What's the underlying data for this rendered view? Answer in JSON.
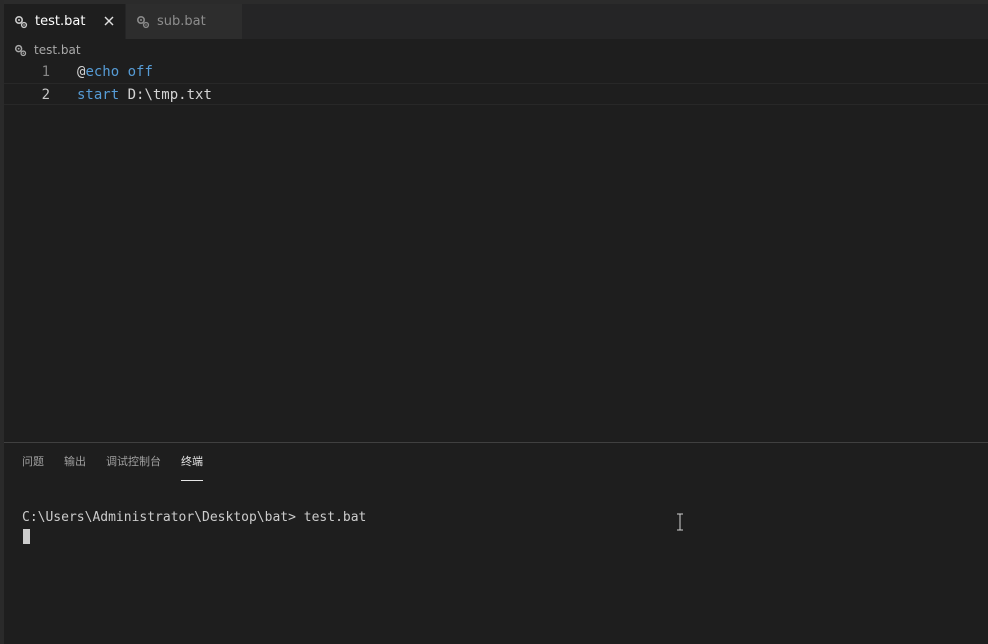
{
  "tabs": [
    {
      "label": "test.bat",
      "active": true,
      "icon": "gear-icon"
    },
    {
      "label": "sub.bat",
      "active": false,
      "icon": "gear-icon"
    }
  ],
  "close_glyph": "✕",
  "breadcrumb": {
    "file": "test.bat"
  },
  "editor": {
    "lines": [
      {
        "number": "1",
        "tokens": [
          {
            "text": "@",
            "kind": "plain"
          },
          {
            "text": "echo off",
            "kind": "kw"
          }
        ]
      },
      {
        "number": "2",
        "tokens": [
          {
            "text": "start",
            "kind": "kw"
          },
          {
            "text": " D:\\tmp.txt",
            "kind": "plain"
          }
        ]
      }
    ]
  },
  "panel": {
    "tabs": [
      "问题",
      "输出",
      "调试控制台",
      "终端"
    ],
    "active_tab": "终端"
  },
  "terminal": {
    "prompt": "C:\\Users\\Administrator\\Desktop\\bat> test.bat"
  },
  "colors": {
    "background": "#1e1e1e",
    "keyword": "#569cd6",
    "text": "#d4d4d4"
  }
}
